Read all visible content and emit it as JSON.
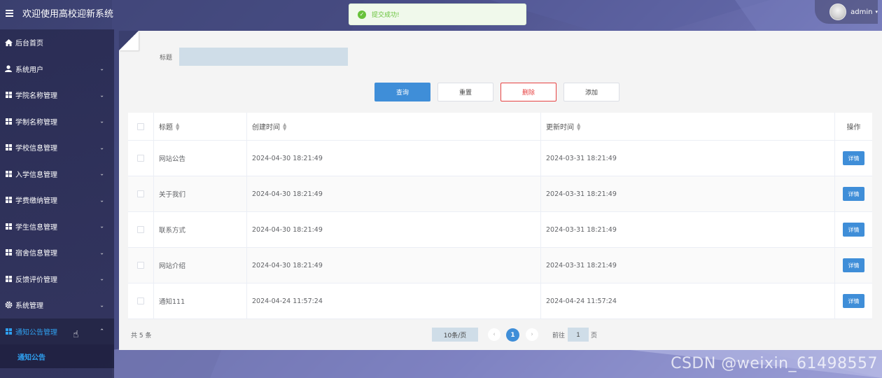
{
  "header": {
    "title": "欢迎使用高校迎新系统",
    "username": "admin",
    "menu_icon": "hamburger-icon"
  },
  "toast": {
    "text": "提交成功!",
    "type": "success"
  },
  "sidebar": {
    "items": [
      {
        "label": "后台首页",
        "icon": "home-icon",
        "has_children": false
      },
      {
        "label": "系统用户",
        "icon": "user-icon",
        "has_children": true
      },
      {
        "label": "学院名称管理",
        "icon": "grid-icon",
        "has_children": true
      },
      {
        "label": "学制名称管理",
        "icon": "grid-icon",
        "has_children": true
      },
      {
        "label": "学校信息管理",
        "icon": "grid-icon",
        "has_children": true
      },
      {
        "label": "入学信息管理",
        "icon": "grid-icon",
        "has_children": true
      },
      {
        "label": "学费缴纳管理",
        "icon": "grid-icon",
        "has_children": true
      },
      {
        "label": "学生信息管理",
        "icon": "grid-icon",
        "has_children": true
      },
      {
        "label": "宿舍信息管理",
        "icon": "grid-icon",
        "has_children": true
      },
      {
        "label": "反馈评价管理",
        "icon": "grid-icon",
        "has_children": true
      },
      {
        "label": "系统管理",
        "icon": "gear-icon",
        "has_children": true
      },
      {
        "label": "通知公告管理",
        "icon": "grid-icon",
        "has_children": true,
        "active": true
      }
    ],
    "active_sub": "通知公告"
  },
  "search": {
    "label": "标题",
    "value": ""
  },
  "buttons": {
    "query": "查询",
    "reset": "重置",
    "delete": "删除",
    "add": "添加"
  },
  "table": {
    "headers": {
      "title": "标题",
      "created": "创建时间",
      "updated": "更新时间",
      "op": "操作"
    },
    "detail_label": "详情",
    "rows": [
      {
        "title": "网站公告",
        "created": "2024-04-30 18:21:49",
        "updated": "2024-03-31 18:21:49"
      },
      {
        "title": "关于我们",
        "created": "2024-04-30 18:21:49",
        "updated": "2024-03-31 18:21:49"
      },
      {
        "title": "联系方式",
        "created": "2024-04-30 18:21:49",
        "updated": "2024-03-31 18:21:49"
      },
      {
        "title": "网站介绍",
        "created": "2024-04-30 18:21:49",
        "updated": "2024-03-31 18:21:49"
      },
      {
        "title": "通知111",
        "created": "2024-04-24 11:57:24",
        "updated": "2024-04-24 11:57:24"
      }
    ]
  },
  "pagination": {
    "total": "共 5 条",
    "page_size": "10条/页",
    "current_page": "1",
    "goto_prefix": "前往",
    "goto_value": "1",
    "goto_suffix": "页"
  },
  "watermark": "CSDN @weixin_61498557",
  "colors": {
    "primary": "#3f8ed8",
    "danger": "#e64242",
    "success": "#67c23a",
    "sidebar_active": "#2fa0f0"
  }
}
